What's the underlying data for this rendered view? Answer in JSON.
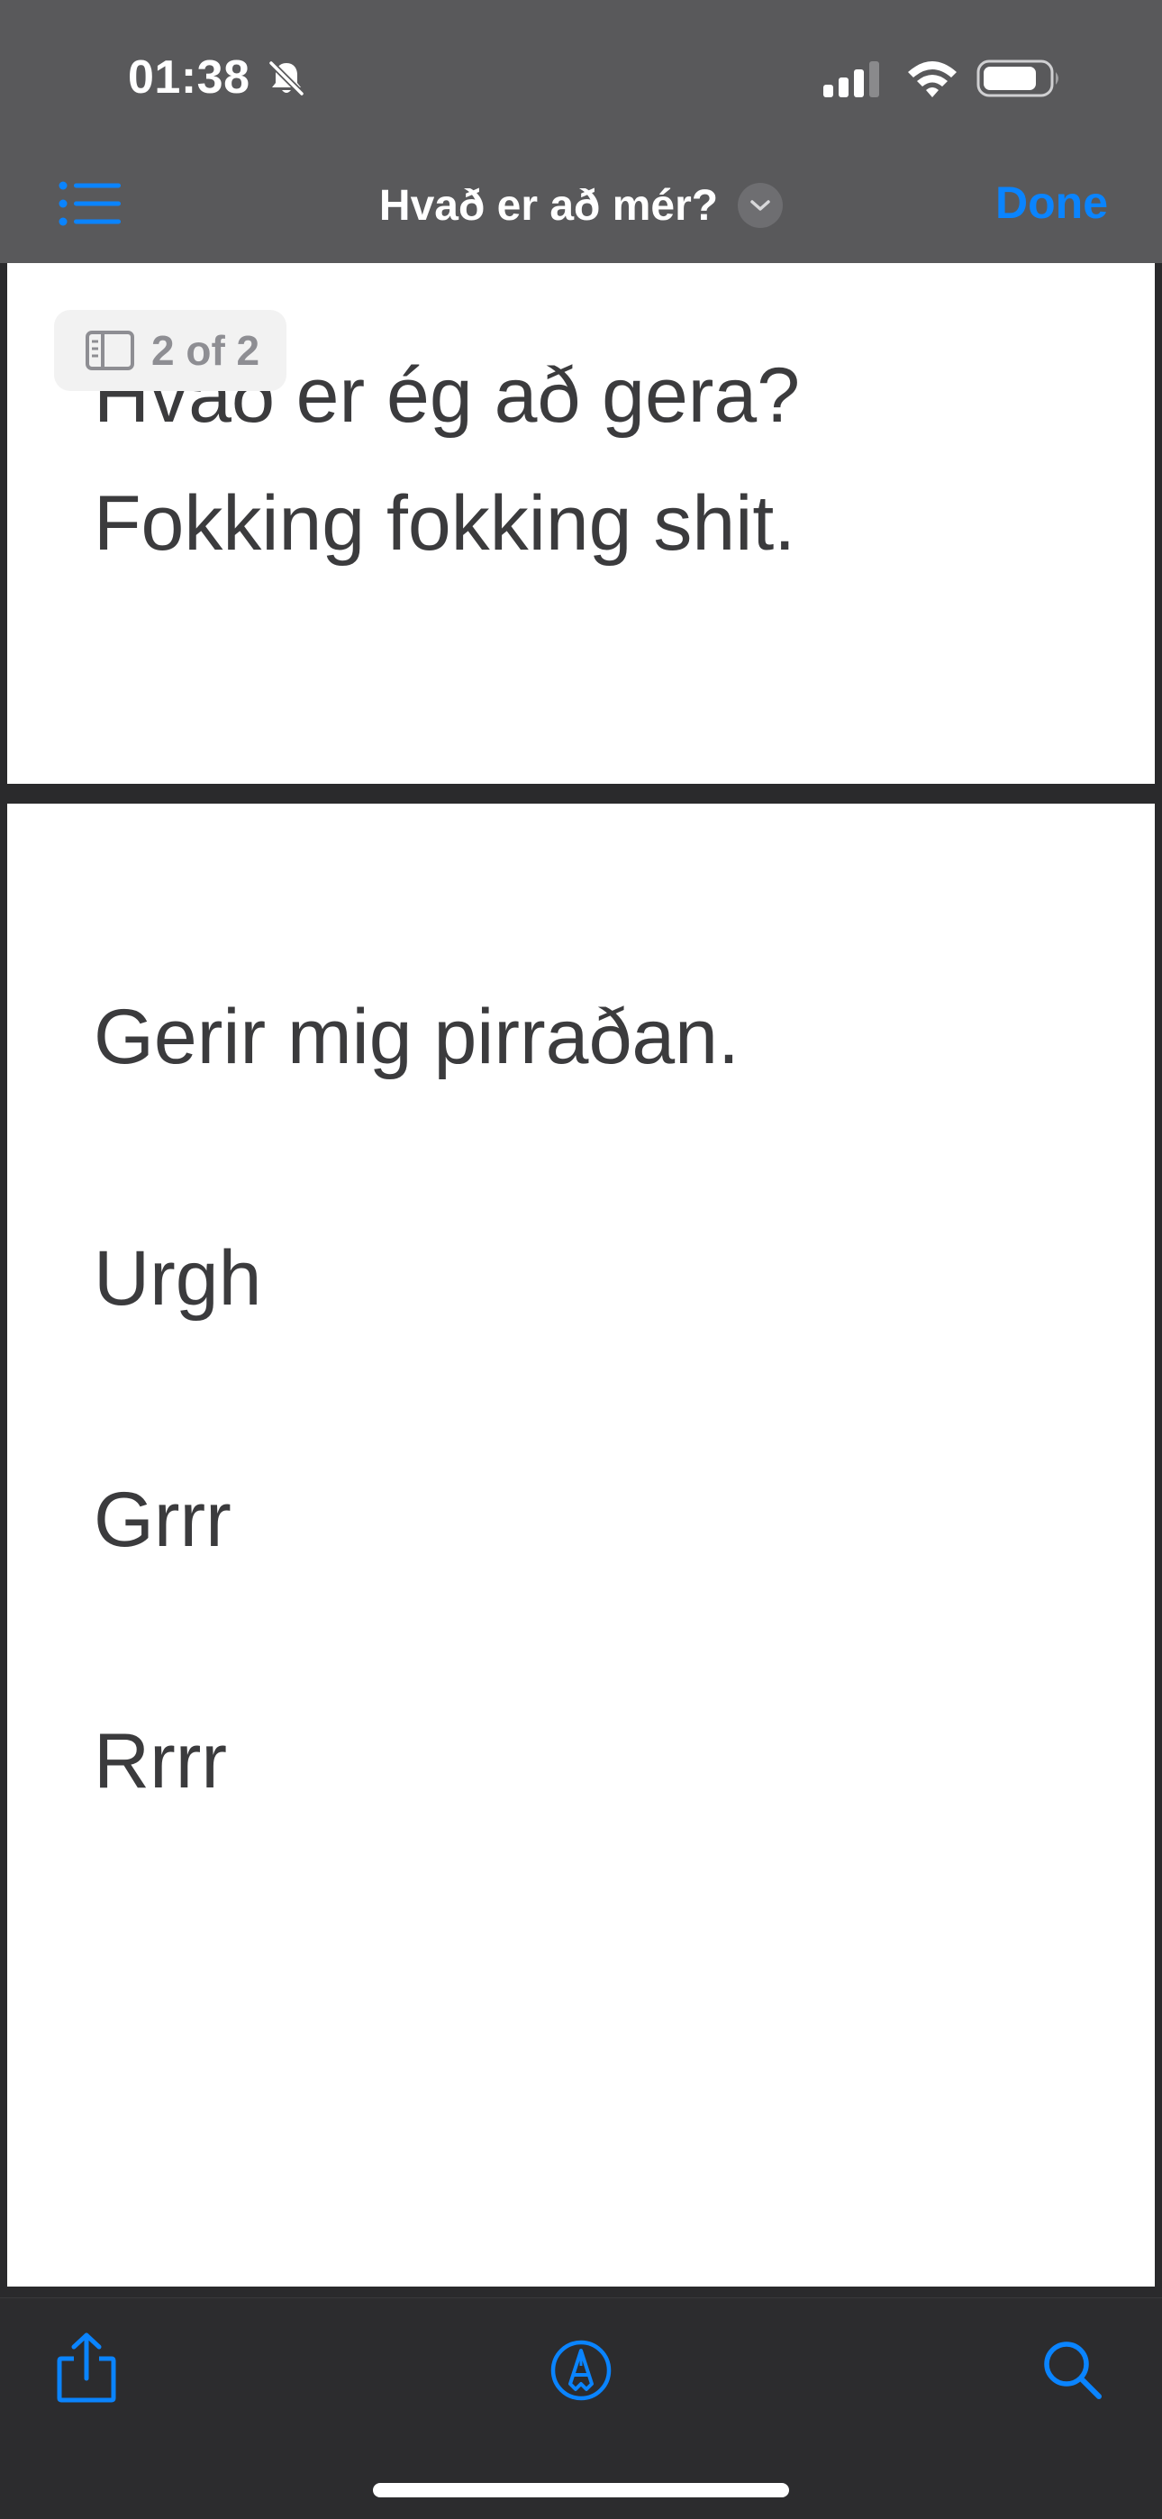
{
  "status_bar": {
    "time": "01:38",
    "icons": [
      "bell-slash-icon",
      "cellular-signal-icon",
      "wifi-icon",
      "battery-icon"
    ]
  },
  "nav": {
    "title": "Hvað er að mér?",
    "done_label": "Done",
    "icons": [
      "list-icon",
      "chevron-down-icon"
    ]
  },
  "page_indicator": {
    "label": "2 of 2",
    "icon": "sidebar-icon"
  },
  "pages": [
    {
      "lines": [
        "Hvað er ég að gera?",
        "Fokking fokking shit."
      ]
    },
    {
      "lines": [
        "Gerir mig pirraðan.",
        "Urgh",
        "Grrr",
        "Rrrr"
      ]
    }
  ],
  "toolbar": {
    "icons": [
      "share-icon",
      "markup-icon",
      "search-icon"
    ]
  },
  "colors": {
    "accent": "#0a84ff",
    "chrome": "#59595b",
    "toolbar": "#2c2c2e",
    "page": "#ffffff",
    "text": "#3b3b3d"
  }
}
